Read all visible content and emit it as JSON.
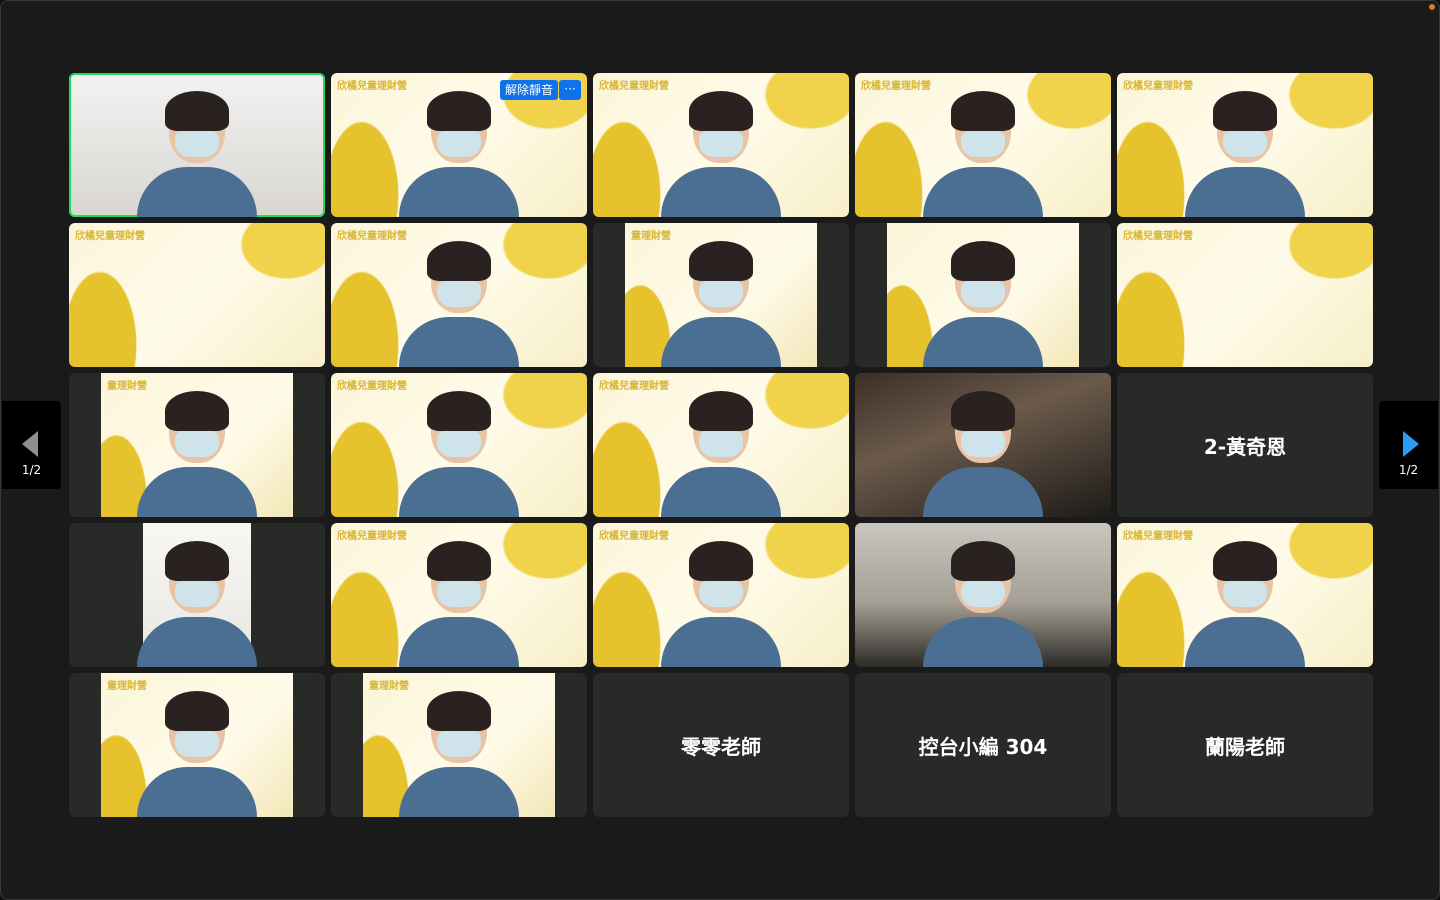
{
  "meeting": {
    "active_speaker_index": 0
  },
  "tiles": [
    {
      "kind": "video",
      "style": "cam-white",
      "watermark": ""
    },
    {
      "kind": "video",
      "style": "video",
      "watermark": "欣橘兒童理財營",
      "unmute_label": "解除靜音",
      "more_label": "···"
    },
    {
      "kind": "video",
      "style": "video",
      "watermark": "欣橘兒童理財營"
    },
    {
      "kind": "video",
      "style": "video",
      "watermark": "欣橘兒童理財營"
    },
    {
      "kind": "video",
      "style": "video",
      "watermark": "欣橘兒童理財營"
    },
    {
      "kind": "video",
      "style": "video",
      "watermark": "欣橘兒童理財營",
      "empty": true
    },
    {
      "kind": "video",
      "style": "video",
      "watermark": "欣橘兒童理財營"
    },
    {
      "kind": "video",
      "style": "pillar",
      "watermark": "童理財營"
    },
    {
      "kind": "video",
      "style": "pillar",
      "watermark": ""
    },
    {
      "kind": "video",
      "style": "video",
      "watermark": "欣橘兒童理財營",
      "empty": true
    },
    {
      "kind": "video",
      "style": "pillar",
      "watermark": "童理財營"
    },
    {
      "kind": "video",
      "style": "video",
      "watermark": "欣橘兒童理財營"
    },
    {
      "kind": "video",
      "style": "video",
      "watermark": "欣橘兒童理財營"
    },
    {
      "kind": "video",
      "style": "cam-dark",
      "watermark": ""
    },
    {
      "kind": "name",
      "name": "2-黃奇恩"
    },
    {
      "kind": "video",
      "style": "pillar-white",
      "watermark": ""
    },
    {
      "kind": "video",
      "style": "video",
      "watermark": "欣橘兒童理財營"
    },
    {
      "kind": "video",
      "style": "video",
      "watermark": "欣橘兒童理財營"
    },
    {
      "kind": "video",
      "style": "cam-room",
      "watermark": ""
    },
    {
      "kind": "video",
      "style": "video",
      "watermark": "欣橘兒童理財營"
    },
    {
      "kind": "video",
      "style": "pillar",
      "watermark": "童理財營"
    },
    {
      "kind": "video",
      "style": "pillar",
      "watermark": "童理財營"
    },
    {
      "kind": "name",
      "name": "零零老師"
    },
    {
      "kind": "name",
      "name": "控台小編 304"
    },
    {
      "kind": "name",
      "name": "蘭陽老師"
    }
  ],
  "pagination": {
    "prev_page": "1/2",
    "next_page": "1/2"
  },
  "colors": {
    "active_border": "#23d95a",
    "button_blue": "#0e72ed",
    "next_arrow": "#2d9cf7",
    "tile_bg": "#272a26",
    "brand_yellow": "#e6c22d"
  }
}
